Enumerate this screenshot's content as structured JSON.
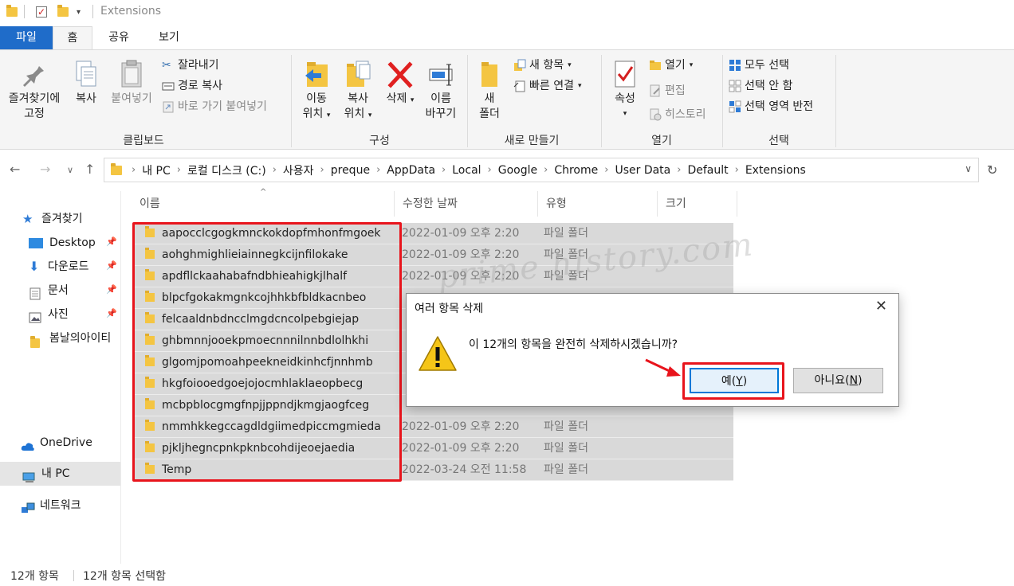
{
  "window": {
    "title": "Extensions"
  },
  "tabs": {
    "file": "파일",
    "home": "홈",
    "share": "공유",
    "view": "보기"
  },
  "ribbon": {
    "clipboard": {
      "label": "클립보드",
      "pin_line1": "즐겨찾기에",
      "pin_line2": "고정",
      "copy": "복사",
      "paste": "붙여넣기",
      "cut": "잘라내기",
      "copy_path": "경로 복사",
      "paste_shortcut": "바로 가기 붙여넣기"
    },
    "organize": {
      "label": "구성",
      "move_line1": "이동",
      "move_line2": "위치",
      "copy_line1": "복사",
      "copy_line2": "위치",
      "delete": "삭제",
      "rename_line1": "이름",
      "rename_line2": "바꾸기"
    },
    "new": {
      "label": "새로 만들기",
      "folder_line1": "새",
      "folder_line2": "폴더",
      "new_item": "새 항목",
      "easy_access": "빠른 연결"
    },
    "open": {
      "label": "열기",
      "properties": "속성",
      "open": "열기",
      "edit": "편집",
      "history": "히스토리"
    },
    "select": {
      "label": "선택",
      "select_all": "모두 선택",
      "select_none": "선택 안 함",
      "invert": "선택 영역 반전"
    }
  },
  "breadcrumb": [
    "내 PC",
    "로컬 디스크 (C:)",
    "사용자",
    "preque",
    "AppData",
    "Local",
    "Google",
    "Chrome",
    "User Data",
    "Default",
    "Extensions"
  ],
  "nav": {
    "quick_access": "즐겨찾기",
    "desktop": "Desktop",
    "downloads": "다운로드",
    "documents": "문서",
    "pictures": "사진",
    "folder": "봄날의아이티",
    "onedrive": "OneDrive",
    "this_pc": "내 PC",
    "network": "네트워크"
  },
  "columns": {
    "name": "이름",
    "modified": "수정한 날짜",
    "type": "유형",
    "size": "크기"
  },
  "files": [
    {
      "name": "aapocclcgogkmnckokdopfmhonfmgoek",
      "date": "2022-01-09 오후 2:20",
      "type": "파일 폴더"
    },
    {
      "name": "aohghmighlieiainnegkcijnfilokake",
      "date": "2022-01-09 오후 2:20",
      "type": "파일 폴더"
    },
    {
      "name": "apdfllckaahabafndbhieahigkjlhalf",
      "date": "2022-01-09 오후 2:20",
      "type": "파일 폴더"
    },
    {
      "name": "blpcfgokakmgnkcojhhkbfbldkacnbeo",
      "date": "",
      "type": ""
    },
    {
      "name": "felcaaldnbdncclmgdcncolpebgiejap",
      "date": "",
      "type": ""
    },
    {
      "name": "ghbmnnjooekpmoecnnnilnnbdlolhkhi",
      "date": "",
      "type": ""
    },
    {
      "name": "glgomjpomoahpeekneidkinhcfjnnhmb",
      "date": "",
      "type": ""
    },
    {
      "name": "hkgfoiooedgoejojocmhlaklaeopbecg",
      "date": "",
      "type": ""
    },
    {
      "name": "mcbpblocgmgfnpjjppndjkmgjaogfceg",
      "date": "",
      "type": ""
    },
    {
      "name": "nmmhkkegccagdldgiimedpiccmgmieda",
      "date": "2022-01-09 오후 2:20",
      "type": "파일 폴더"
    },
    {
      "name": "pjkljhegncpnkpknbcohdijeoejaedia",
      "date": "2022-01-09 오후 2:20",
      "type": "파일 폴더"
    },
    {
      "name": "Temp",
      "date": "2022-03-24 오전 11:58",
      "type": "파일 폴더"
    }
  ],
  "watermark": "prime history.com",
  "dialog": {
    "title": "여러 항목 삭제",
    "message": "이 12개의 항목을 완전히 삭제하시겠습니까?",
    "yes_main": "예(",
    "yes_key": "Y",
    "yes_end": ")",
    "no_main": "아니요(",
    "no_key": "N",
    "no_end": ")"
  },
  "status": {
    "count": "12개 항목",
    "selected": "12개 항목 선택함"
  },
  "colors": {
    "accent": "#1f6cc9",
    "highlight": "#e8141c",
    "selection": "#d9d9d9"
  }
}
